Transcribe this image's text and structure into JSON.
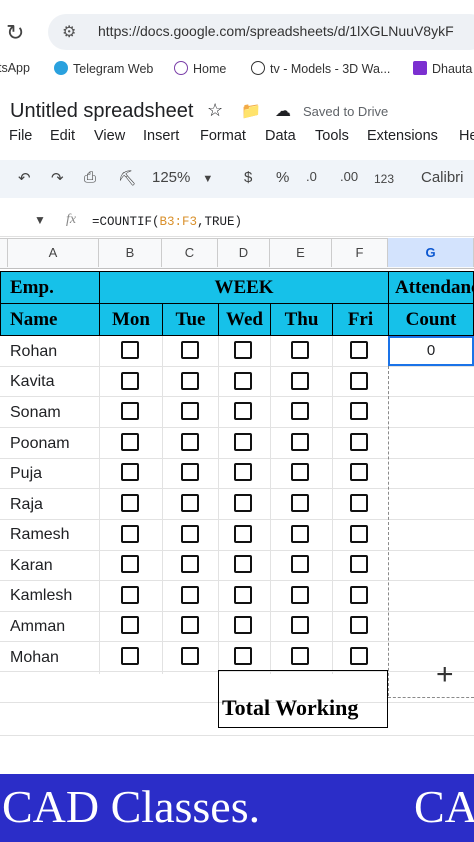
{
  "browser": {
    "url": "https://docs.google.com/spreadsheets/d/1lXGLNuuV8ykF",
    "bookmarks": [
      {
        "label": "tsApp",
        "icon": "whatsapp-icon"
      },
      {
        "label": "Telegram Web",
        "icon": "telegram-icon"
      },
      {
        "label": "Home",
        "icon": "home-icon"
      },
      {
        "label": "tv - Models - 3D Wa...",
        "icon": "tv-icon"
      },
      {
        "label": "Dhauta",
        "icon": "dhauta-icon"
      }
    ]
  },
  "sheets": {
    "title": "Untitled spreadsheet",
    "saved_status": "Saved to Drive",
    "menu": [
      "File",
      "Edit",
      "View",
      "Insert",
      "Format",
      "Data",
      "Tools",
      "Extensions",
      "He"
    ],
    "toolbar": {
      "zoom": "125%",
      "currency": "$",
      "percent": "%",
      "decrease_decimal": ".0",
      "increase_decimal": ".00",
      "number_format": "123",
      "font": "Calibri"
    },
    "formula_bar": {
      "fx": "fx",
      "prefix": "=COUNTIF(",
      "range": "B3:F3",
      "suffix": ",TRUE)"
    },
    "columns": [
      "A",
      "B",
      "C",
      "D",
      "E",
      "F",
      "G"
    ]
  },
  "table": {
    "header_emp": "Emp.",
    "header_name": "Name",
    "header_week": "WEEK",
    "days": [
      "Mon",
      "Tue",
      "Wed",
      "Thu",
      "Fri"
    ],
    "header_attendance": "Attendance",
    "header_count": "Count",
    "employees": [
      "Rohan",
      "Kavita",
      "Sonam",
      "Poonam",
      "Puja",
      "Raja",
      "Ramesh",
      "Karan",
      "Kamlesh",
      "Amman",
      "Mohan"
    ],
    "first_count": "0",
    "total_label": "Total Working"
  },
  "banner": {
    "text": "CAD Classes.",
    "text_repeat": "CA"
  },
  "colors": {
    "header_fill": "#16c1e9",
    "banner_fill": "#2b2dc8",
    "selection": "#1a73e8"
  }
}
